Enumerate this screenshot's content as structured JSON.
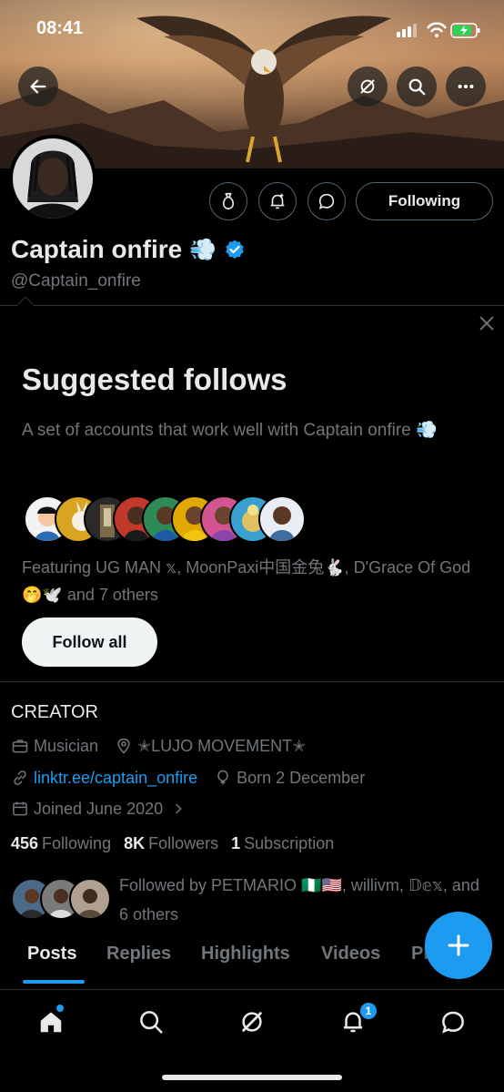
{
  "status_bar": {
    "time": "08:41"
  },
  "profile": {
    "name": "Captain onfire",
    "name_emoji": "💨",
    "handle": "@Captain_onfire",
    "following_label": "Following"
  },
  "suggested": {
    "title": "Suggested follows",
    "description": "A set of accounts that work well with Captain onfire 💨",
    "featuring": "Featuring UG MAN 𝕩, MoonPaxi中国金兔🐇, D'Grace Of God🤭🕊️ and 7 others",
    "follow_all_label": "Follow all"
  },
  "bio": {
    "text": "CREATOR",
    "category": "Musician",
    "location": "✭LUJO MOVEMENT✭",
    "website": "linktr.ee/captain_onfire",
    "birthday": "Born 2 December",
    "joined": "Joined June 2020"
  },
  "stats": {
    "following_count": "456",
    "following_label": "Following",
    "followers_count": "8K",
    "followers_label": "Followers",
    "subscription_count": "1",
    "subscription_label": "Subscription"
  },
  "followed_by": "Followed by PETMARIO 🇳🇬🇺🇸, willivm, 𝔻𝕖𝕩, and 6 others",
  "tabs": [
    {
      "label": "Posts"
    },
    {
      "label": "Replies"
    },
    {
      "label": "Highlights"
    },
    {
      "label": "Videos"
    },
    {
      "label": "Ph"
    }
  ],
  "bottom_nav": {
    "notifications_badge": "1"
  },
  "colors": {
    "accent": "#1d9bf0",
    "background": "#000000",
    "muted": "#71767b"
  }
}
